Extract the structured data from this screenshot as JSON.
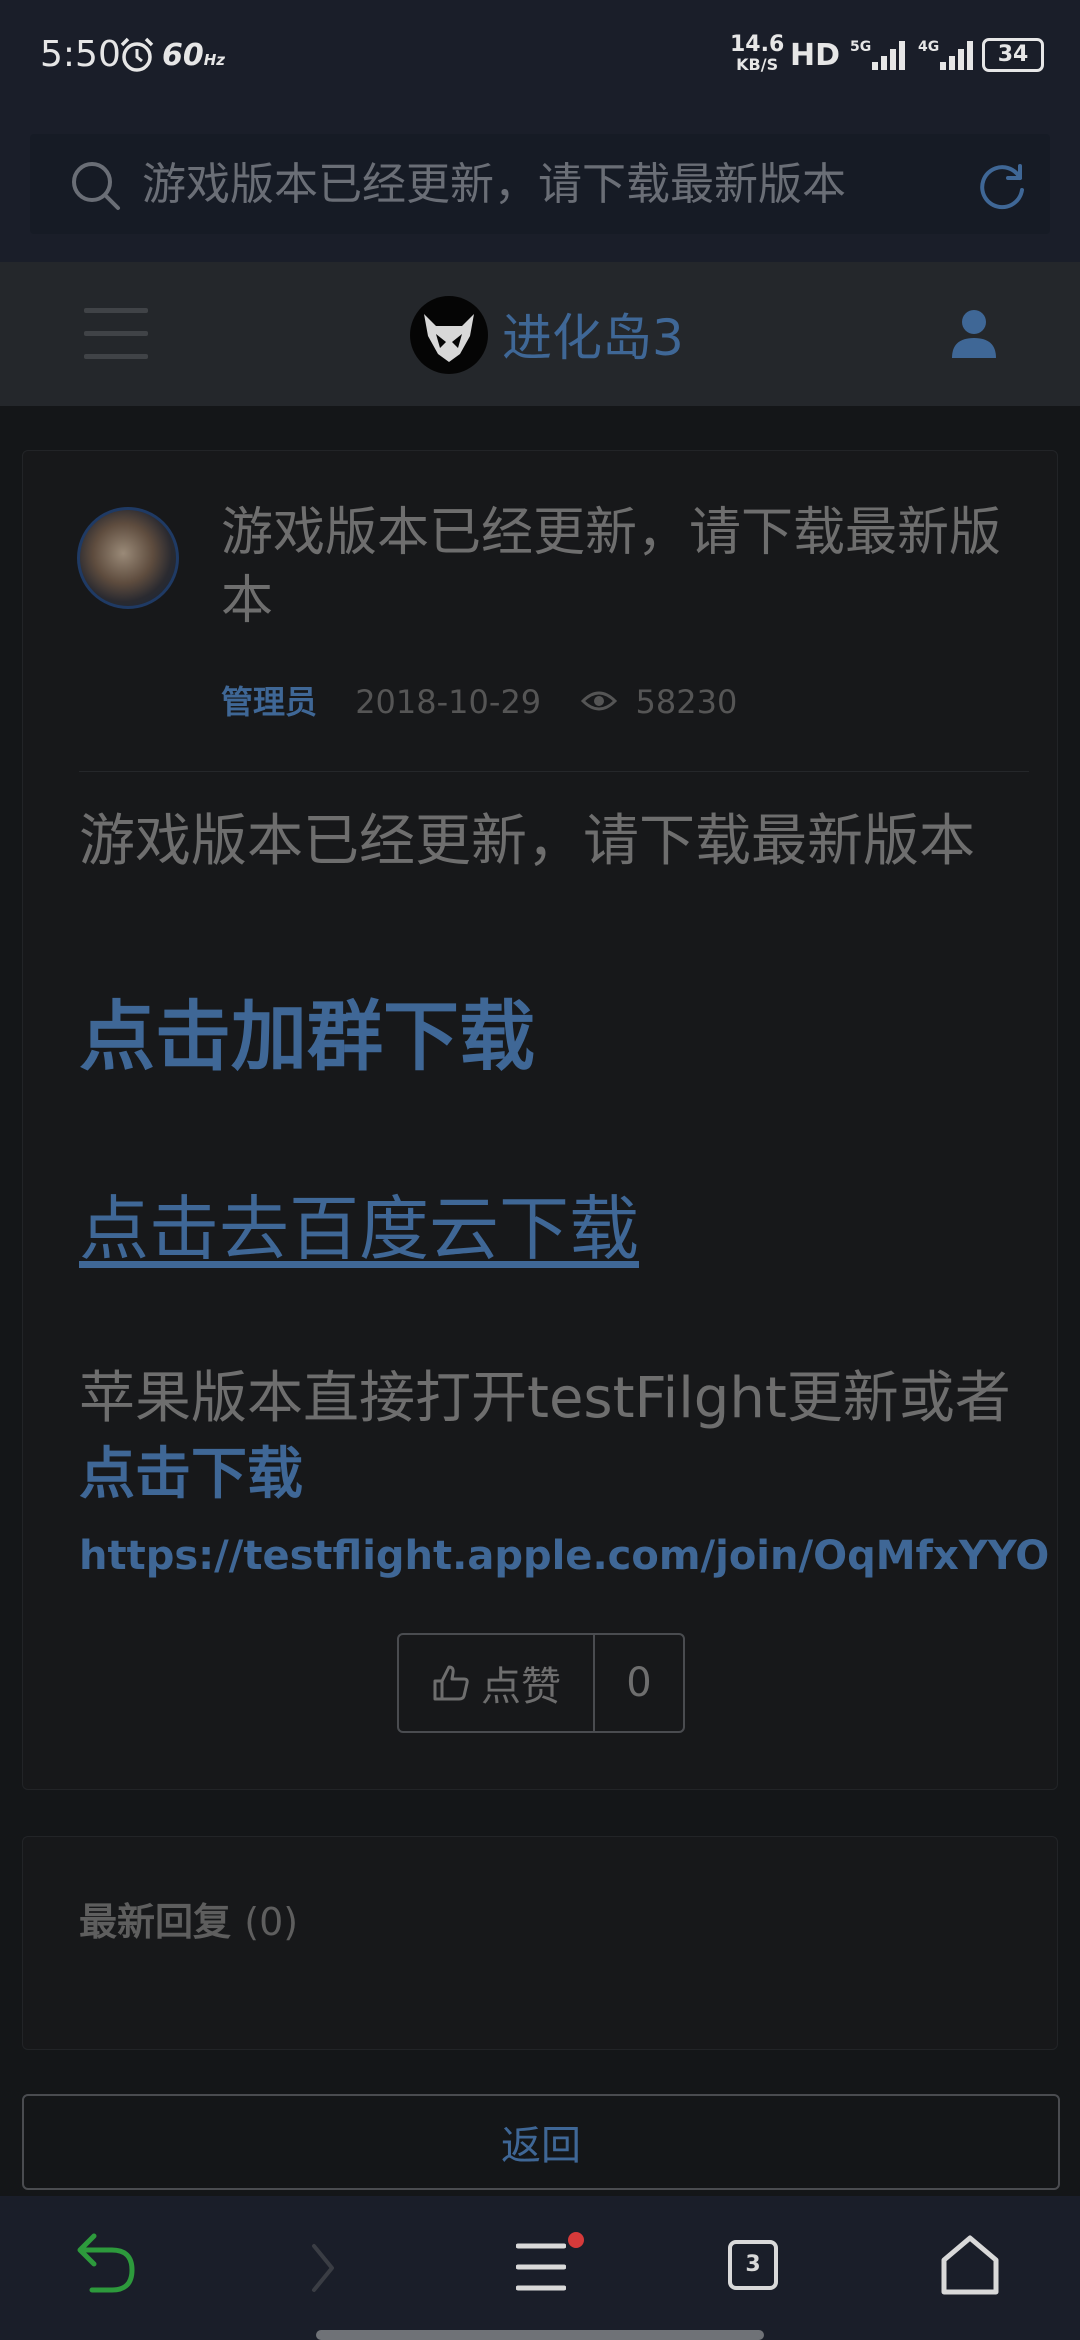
{
  "status_bar": {
    "time": "5:50",
    "refresh_rate": "60",
    "refresh_rate_unit": "Hz",
    "net_speed_value": "14.6",
    "net_speed_unit": "KB/S",
    "hd_label": "HD",
    "sim1_label": "5G",
    "sim2_label": "4G",
    "battery": "34"
  },
  "search": {
    "placeholder": "游戏版本已经更新，请下载最新版本"
  },
  "header": {
    "site_title": "进化岛3"
  },
  "post": {
    "title": "游戏版本已经更新，请下载最新版本",
    "author": "管理员",
    "date": "2018-10-29",
    "views": "58230",
    "body_line1": "游戏版本已经更新，请下载最新版本",
    "link_join_group": "点击加群下载",
    "link_baidu": "点击去百度云下载",
    "body_line2": "苹果版本直接打开testFilght更新或者 ",
    "link_download": "点击下载",
    "link_url": "https://testflight.apple.com/join/OqMfxYYO",
    "like_label": "点赞",
    "like_count": "0"
  },
  "replies": {
    "title": "最新回复",
    "count": "(0)"
  },
  "back_button_label": "返回",
  "bottom_nav": {
    "tab_count": "3"
  },
  "colors": {
    "accent": "#3f6796",
    "background": "#141618",
    "card": "#17181a",
    "status_bar": "#1a1e29",
    "notification_dot": "#d63a3a",
    "back_arrow": "#2d9a3c"
  }
}
